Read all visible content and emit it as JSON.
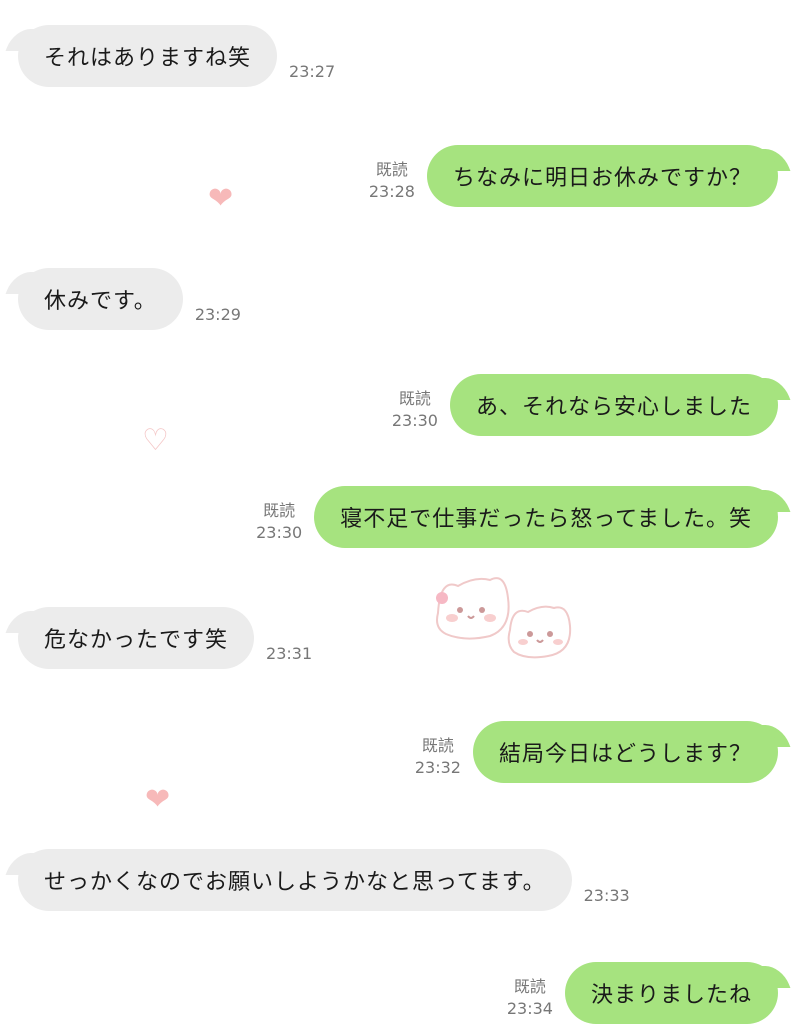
{
  "messages": [
    {
      "dir": "in",
      "text": "それはありますね笑",
      "time": "23:27"
    },
    {
      "dir": "out",
      "text": "ちなみに明日お休みですか？",
      "time": "23:28",
      "read": "既読"
    },
    {
      "dir": "in",
      "text": "休みです。",
      "time": "23:29"
    },
    {
      "dir": "out",
      "text": "あ、それなら安心しました",
      "time": "23:30",
      "read": "既読"
    },
    {
      "dir": "out",
      "text": "寝不足で仕事だったら怒ってました。笑",
      "time": "23:30",
      "read": "既読"
    },
    {
      "dir": "in",
      "text": "危なかったです笑",
      "time": "23:31"
    },
    {
      "dir": "out",
      "text": "結局今日はどうします？",
      "time": "23:32",
      "read": "既読"
    },
    {
      "dir": "in",
      "text": "せっかくなのでお願いしようかなと思ってます。",
      "time": "23:33"
    },
    {
      "dir": "out",
      "text": "決まりましたね",
      "time": "23:34",
      "read": "既読"
    }
  ],
  "colors": {
    "incoming_bubble": "#ececec",
    "outgoing_bubble": "#a6e37f",
    "meta_text": "#777777",
    "heart": "#f7b9b9"
  },
  "icons": {
    "decor_heart": "heart-icon",
    "decor_cats": "cat-sticker-icon"
  }
}
